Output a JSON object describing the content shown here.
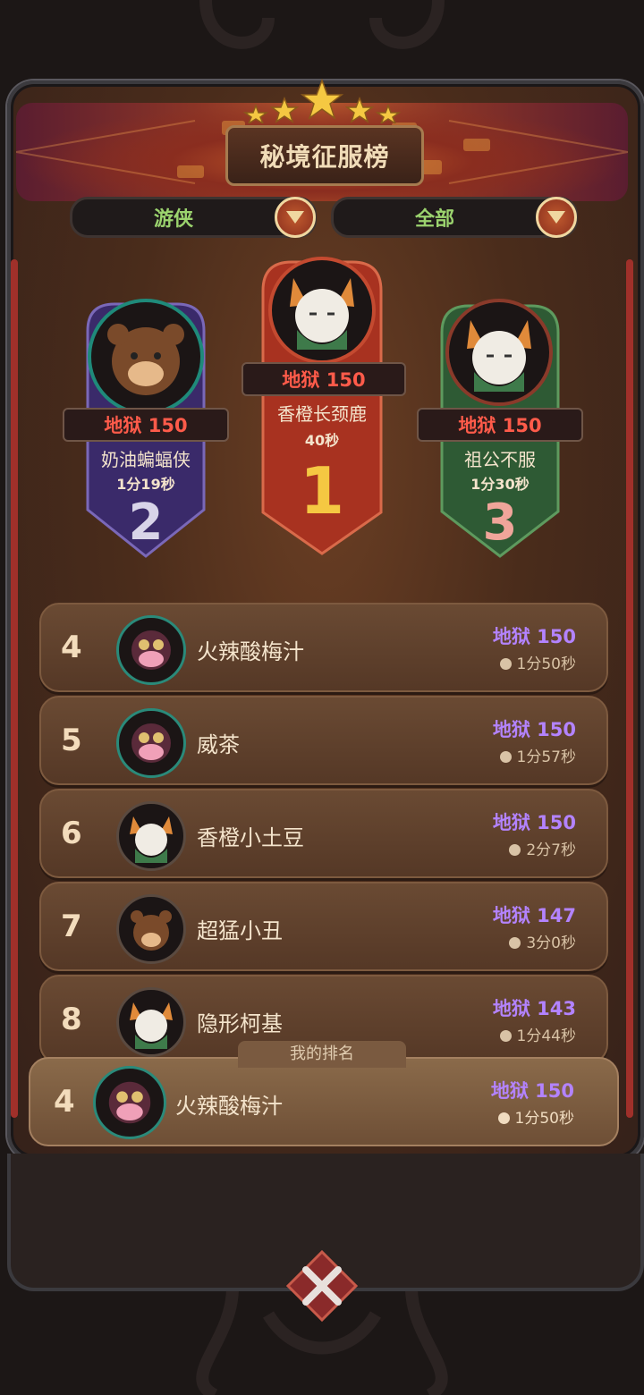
{
  "title": "秘境征服榜",
  "filters": [
    {
      "label": "游侠"
    },
    {
      "label": "全部"
    }
  ],
  "podium": [
    {
      "rank": "2",
      "difficulty": "地狱 150",
      "name": "奶油蝙蝠侠",
      "time": "1分19秒",
      "avatar": "bear-avatar-icon"
    },
    {
      "rank": "1",
      "difficulty": "地狱 150",
      "name": "香橙长颈鹿",
      "time": "40秒",
      "avatar": "fox-avatar-icon"
    },
    {
      "rank": "3",
      "difficulty": "地狱 150",
      "name": "祖公不服",
      "time": "1分30秒",
      "avatar": "fox-avatar-icon"
    }
  ],
  "rows": [
    {
      "rank": "4",
      "name": "火辣酸梅汁",
      "difficulty": "地狱 150",
      "time": "1分50秒",
      "avatar": "cow-avatar-icon"
    },
    {
      "rank": "5",
      "name": "威茶",
      "difficulty": "地狱 150",
      "time": "1分57秒",
      "avatar": "cow-avatar-icon"
    },
    {
      "rank": "6",
      "name": "香橙小土豆",
      "difficulty": "地狱 150",
      "time": "2分7秒",
      "avatar": "fox-avatar-icon"
    },
    {
      "rank": "7",
      "name": "超猛小丑",
      "difficulty": "地狱 147",
      "time": "3分0秒",
      "avatar": "bear-avatar-icon"
    },
    {
      "rank": "8",
      "name": "隐形柯基",
      "difficulty": "地狱 143",
      "time": "1分44秒",
      "avatar": "fox-avatar-icon"
    }
  ],
  "my_rank": {
    "tab_label": "我的排名",
    "rank": "4",
    "name": "火辣酸梅汁",
    "difficulty": "地狱 150",
    "time": "1分50秒",
    "avatar": "cow-avatar-icon"
  },
  "colors": {
    "difficulty_purple": "#b383ff",
    "difficulty_red": "#ff5b4a",
    "filter_green": "#9bd36e",
    "gold": "#f5c842"
  }
}
